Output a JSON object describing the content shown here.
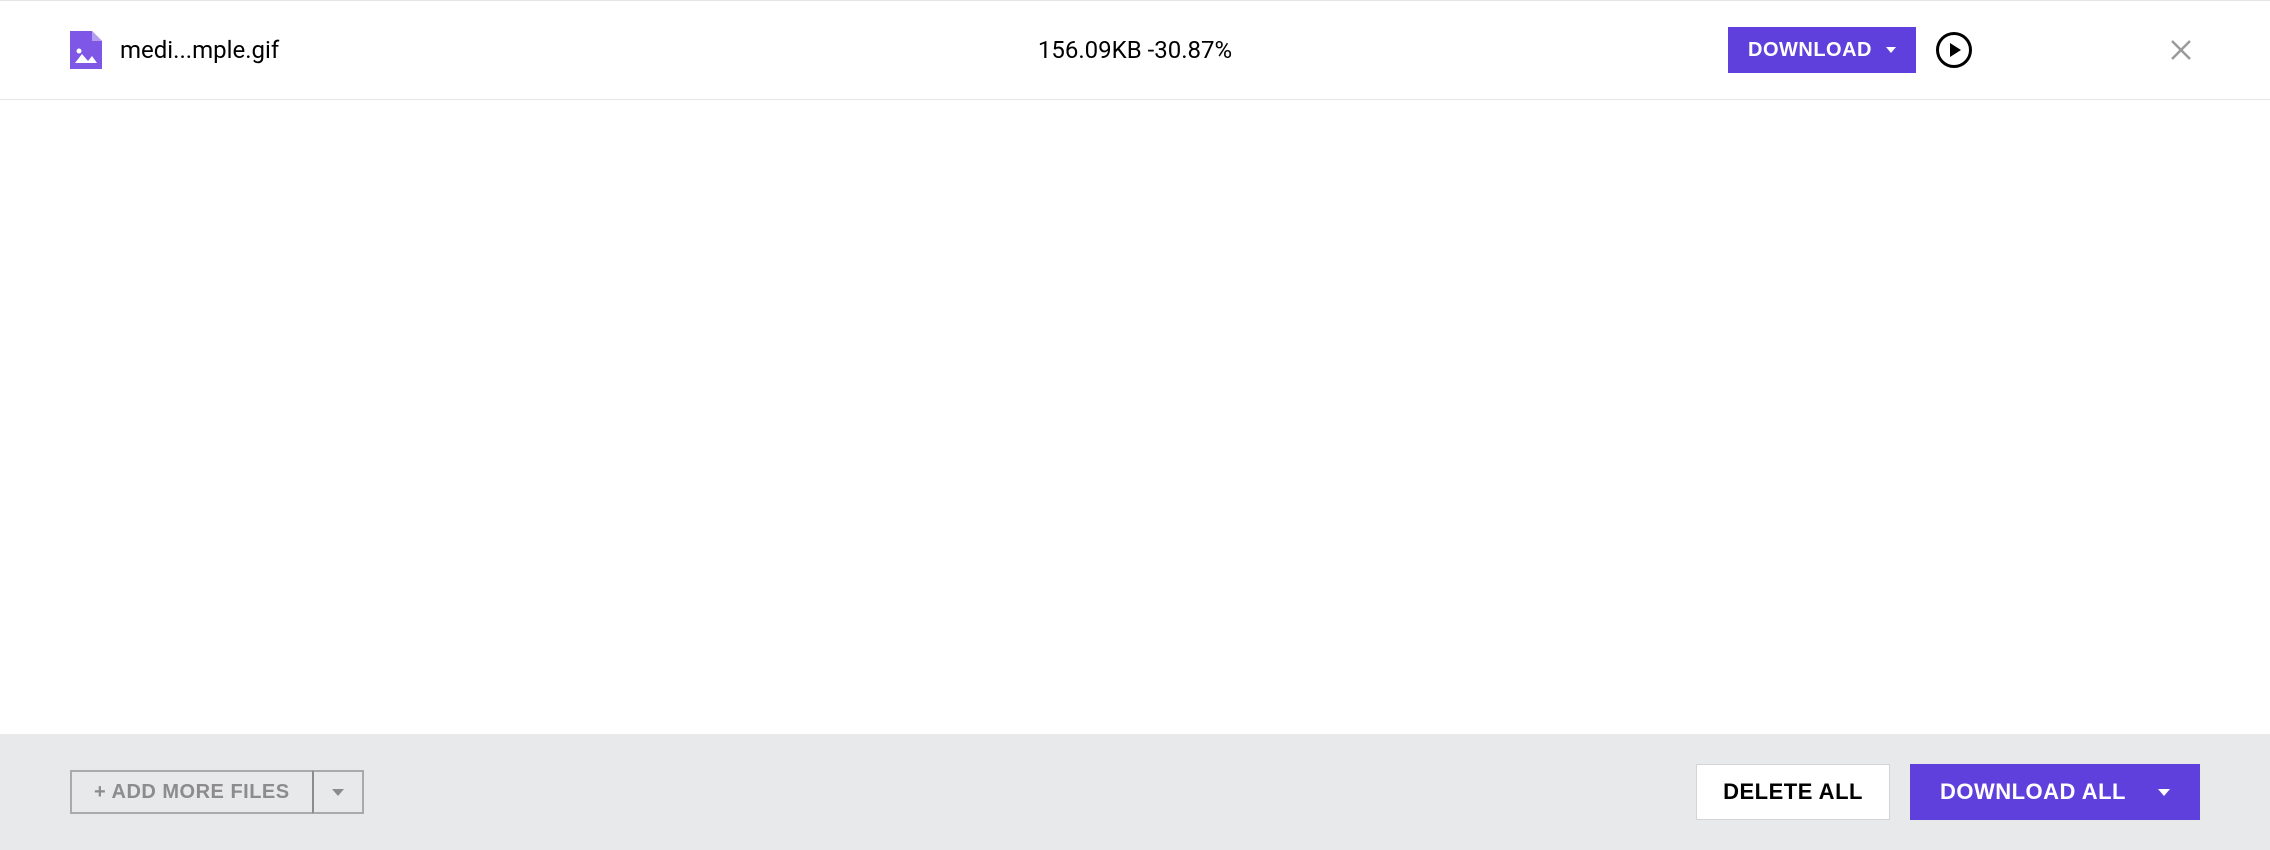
{
  "file_row": {
    "filename": "medi...mple.gif",
    "size": "156.09KB",
    "reduction": "-30.87%",
    "download_label": "DOWNLOAD"
  },
  "footer": {
    "add_more_label": "+ ADD MORE FILES",
    "delete_all_label": "DELETE ALL",
    "download_all_label": "DOWNLOAD ALL"
  },
  "colors": {
    "accent": "#5f40dd",
    "footer_bg": "#e8e9eb"
  }
}
